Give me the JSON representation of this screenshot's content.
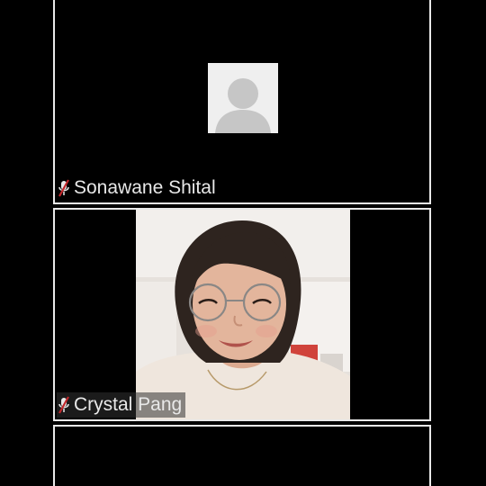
{
  "participants": [
    {
      "name": "Sonawane Shital",
      "video": "off",
      "mic": "muted",
      "avatar_icon": "default-person-icon"
    },
    {
      "name": "Crystal Pang",
      "video": "on",
      "mic": "muted"
    },
    {
      "name": "",
      "video": "off"
    }
  ],
  "colors": {
    "background": "#000000",
    "tile_border": "#e9e9e9",
    "name_text": "#e8e8e8",
    "muted_mic": "#c0262a"
  }
}
